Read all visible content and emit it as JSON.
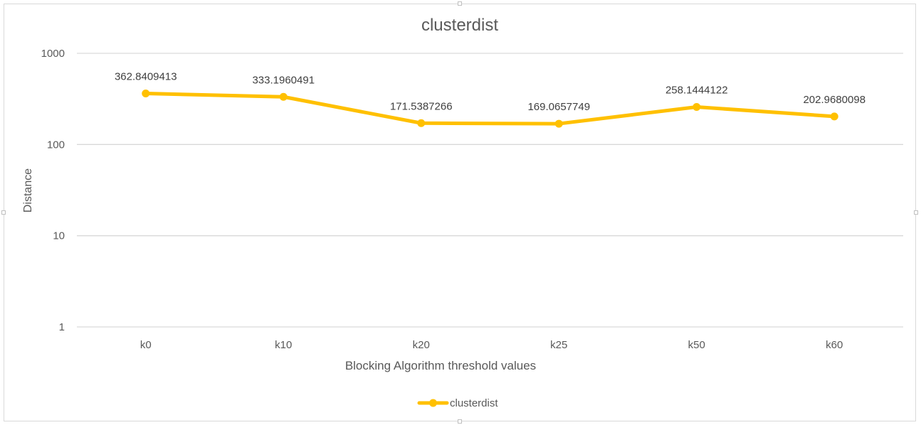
{
  "chart_data": {
    "type": "line",
    "title": "clusterdist",
    "xlabel": "Blocking Algorithm threshold values",
    "ylabel": "Distance",
    "y_scale": "log",
    "ylim": [
      1,
      1000
    ],
    "y_ticks": [
      1,
      10,
      100,
      1000
    ],
    "y_tick_labels": [
      "1",
      "10",
      "100",
      "1000"
    ],
    "categories": [
      "k0",
      "k10",
      "k20",
      "k25",
      "k50",
      "k60"
    ],
    "series": [
      {
        "name": "clusterdist",
        "values": [
          362.8409413,
          333.1960491,
          171.5387266,
          169.0657749,
          258.1444122,
          202.9680098
        ],
        "labels": [
          "362.8409413",
          "333.1960491",
          "171.5387266",
          "169.0657749",
          "258.1444122",
          "202.9680098"
        ],
        "color": "#FFC000"
      }
    ],
    "grid": true,
    "legend_position": "bottom"
  }
}
